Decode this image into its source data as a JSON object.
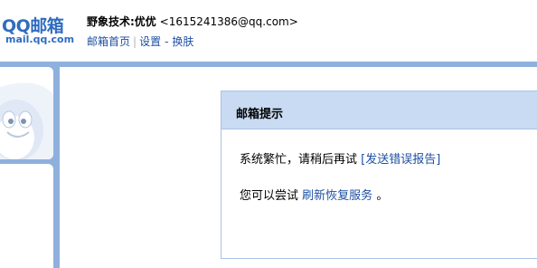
{
  "header": {
    "logo_main": "QQ邮箱",
    "logo_sub": "mail.qq.com",
    "user_name": "野象技术:优优",
    "user_email": "<1615241386@qq.com>",
    "nav": {
      "home": "邮箱首页",
      "separator": "|",
      "settings": "设置",
      "dash": "-",
      "skin": "换肤"
    }
  },
  "message": {
    "title": "邮箱提示",
    "line1_text": "系统繁忙，请稍后再试",
    "line1_link": "[发送错误报告]",
    "line2_text": "您可以尝试",
    "line2_link": "刷新恢复服务",
    "line2_end": "。"
  },
  "colors": {
    "brand": "#2f6cc0",
    "link": "#1e50a2",
    "frame": "#8fb0dd",
    "title_bar": "#c8dbf2"
  }
}
